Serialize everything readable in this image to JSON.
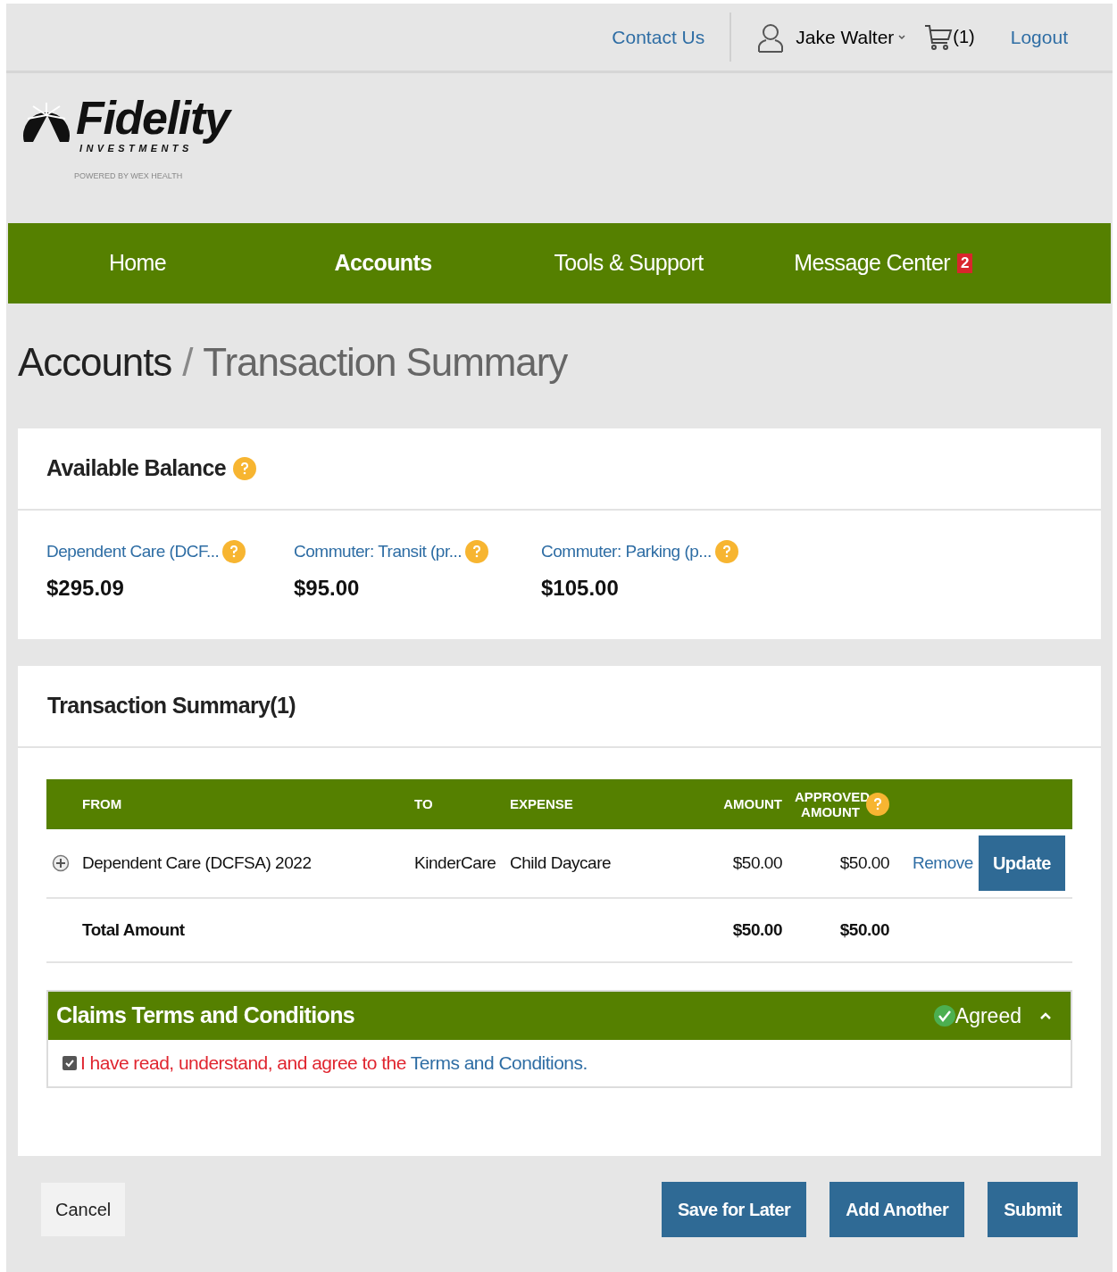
{
  "top_bar": {
    "contact": "Contact Us",
    "user": "Jake Walter",
    "cart": "(1)",
    "logout": "Logout"
  },
  "logo": {
    "name": "Fidelity",
    "subtitle": "INVESTMENTS",
    "powered_by": "POWERED BY WEX HEALTH"
  },
  "nav": [
    {
      "label": "Home",
      "selected": false
    },
    {
      "label": "Accounts",
      "selected": true
    },
    {
      "label": "Tools & Support",
      "selected": false
    },
    {
      "label": "Message Center",
      "selected": false,
      "badge": "2"
    }
  ],
  "breadcrumb": {
    "parent": "Accounts",
    "separator": "/",
    "current": "Transaction Summary"
  },
  "balance": {
    "title": "Available Balance",
    "accounts": [
      {
        "name": "Dependent Care (DCF...",
        "amount": "$295.09"
      },
      {
        "name": "Commuter: Transit (pr...",
        "amount": "$95.00"
      },
      {
        "name": "Commuter: Parking (p...",
        "amount": "$105.00"
      }
    ]
  },
  "summary": {
    "title": "Transaction Summary(1)",
    "columns": [
      "FROM",
      "TO",
      "EXPENSE",
      "AMOUNT",
      "APPROVED AMOUNT"
    ],
    "rows": [
      {
        "from": "Dependent Care (DCFSA) 2022",
        "to": "KinderCare",
        "expense": "Child Daycare",
        "amount": "$50.00",
        "approved": "$50.00",
        "remove": "Remove",
        "update": "Update"
      }
    ],
    "total": {
      "label": "Total Amount",
      "amount": "$50.00",
      "approved": "$50.00"
    }
  },
  "terms": {
    "title": "Claims Terms and Conditions",
    "status": "Agreed",
    "expanded": true,
    "checked": true,
    "statement": "I have read, understand, and agree to the",
    "link": "Terms and Conditions",
    "end": "."
  },
  "buttons": {
    "cancel": "Cancel",
    "actions": [
      "Save for Later",
      "Add Another",
      "Submit"
    ]
  }
}
